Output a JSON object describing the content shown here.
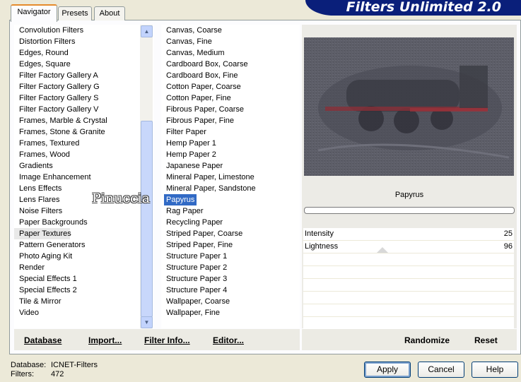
{
  "app": {
    "title": "Filters Unlimited 2.0"
  },
  "tabs": [
    {
      "label": "Navigator",
      "active": true
    },
    {
      "label": "Presets",
      "active": false
    },
    {
      "label": "About",
      "active": false
    }
  ],
  "categories": [
    "Convolution Filters",
    "Distortion Filters",
    "Edges, Round",
    "Edges, Square",
    "Filter Factory Gallery A",
    "Filter Factory Gallery G",
    "Filter Factory Gallery S",
    "Filter Factory Gallery V",
    "Frames, Marble & Crystal",
    "Frames, Stone & Granite",
    "Frames, Textured",
    "Frames, Wood",
    "Gradients",
    "Image Enhancement",
    "Lens Effects",
    "Lens Flares",
    "Noise Filters",
    "Paper Backgrounds",
    "Paper Textures",
    "Pattern Generators",
    "Photo Aging Kit",
    "Render",
    "Special Effects 1",
    "Special Effects 2",
    "Tile & Mirror",
    "Video"
  ],
  "selected_category": "Paper Textures",
  "filters": [
    "Canvas, Coarse",
    "Canvas, Fine",
    "Canvas, Medium",
    "Cardboard Box, Coarse",
    "Cardboard Box, Fine",
    "Cotton Paper, Coarse",
    "Cotton Paper, Fine",
    "Fibrous Paper, Coarse",
    "Fibrous Paper, Fine",
    "Filter Paper",
    "Hemp Paper 1",
    "Hemp Paper 2",
    "Japanese Paper",
    "Mineral Paper, Limestone",
    "Mineral Paper, Sandstone",
    "Papyrus",
    "Rag Paper",
    "Recycling Paper",
    "Striped Paper, Coarse",
    "Striped Paper, Fine",
    "Structure Paper 1",
    "Structure Paper 2",
    "Structure Paper 3",
    "Structure Paper 4",
    "Wallpaper, Coarse",
    "Wallpaper, Fine"
  ],
  "selected_filter": "Papyrus",
  "preview": {
    "filter_name": "Papyrus"
  },
  "params": [
    {
      "label": "Intensity",
      "value": "25"
    },
    {
      "label": "Lightness",
      "value": "96"
    }
  ],
  "left_buttons": {
    "database": "Database",
    "import": "Import...",
    "filter_info": "Filter Info...",
    "editor": "Editor..."
  },
  "right_buttons": {
    "randomize": "Randomize",
    "reset": "Reset"
  },
  "dialog_buttons": {
    "apply": "Apply",
    "cancel": "Cancel",
    "help": "Help"
  },
  "status": {
    "database_label": "Database:",
    "database_value": "ICNET-Filters",
    "filters_label": "Filters:",
    "filters_value": "472"
  },
  "watermark": "Pinuccia",
  "colors": {
    "banner": "#0a1f7a",
    "selection": "#316ac5",
    "tab_highlight": "#e68b2c"
  }
}
